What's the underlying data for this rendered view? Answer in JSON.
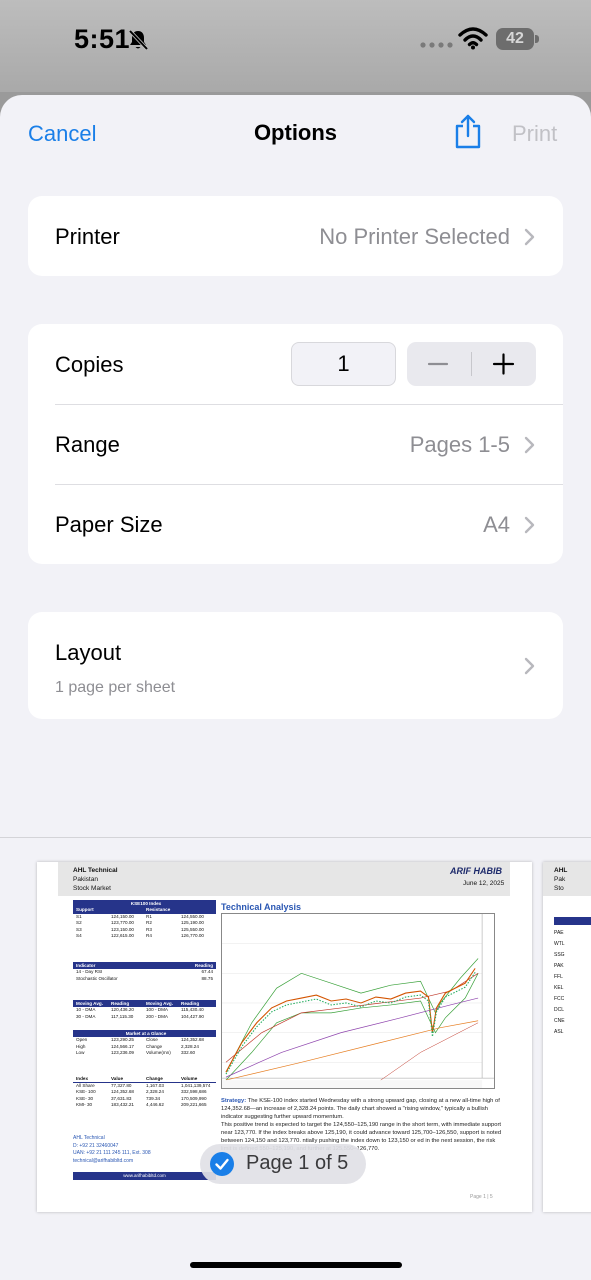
{
  "status_bar": {
    "time": "5:51",
    "battery": "42",
    "icons": [
      "bell-slash-icon",
      "signal-dots-icon",
      "wifi-icon",
      "battery-icon"
    ]
  },
  "nav": {
    "cancel": "Cancel",
    "title": "Options",
    "print": "Print",
    "share_icon": "share-icon",
    "accent_color": "#1a7fe8",
    "disabled_color": "#c1c1c6"
  },
  "printer": {
    "label": "Printer",
    "value": "No Printer Selected"
  },
  "copies": {
    "label": "Copies",
    "value": "1",
    "minus": "−",
    "plus": "+"
  },
  "range": {
    "label": "Range",
    "value": "Pages 1-5"
  },
  "paper_size": {
    "label": "Paper Size",
    "value": "A4"
  },
  "layout": {
    "label": "Layout",
    "sub": "1 page per sheet"
  },
  "preview": {
    "page_indicator": "Page 1 of 5",
    "doc": {
      "header_left": [
        "AHL Technical",
        "Pakistan",
        "Stock Market"
      ],
      "logo": "ARIF HABIB",
      "date": "June 12, 2025",
      "kse_title": "KSE100 Index",
      "support_header": "Support",
      "resistance_header": "Resistance",
      "levels": [
        [
          "S1",
          "124,150.00",
          "R1",
          "124,550.00"
        ],
        [
          "S2",
          "123,770.00",
          "R2",
          "125,190.00"
        ],
        [
          "S3",
          "123,150.00",
          "R3",
          "125,550.00"
        ],
        [
          "S4",
          "122,615.00",
          "R4",
          "126,770.00"
        ]
      ],
      "indicator_header": [
        "Indicator",
        "Reading"
      ],
      "indicators": [
        [
          "14 - Day RSI",
          "67.44"
        ],
        [
          "Stochastic Oscillator",
          "88.75"
        ]
      ],
      "ma_header": [
        "Moving Avg.",
        "Reading",
        "Moving Avg.",
        "Reading"
      ],
      "ma_rows": [
        [
          "10 - DMA",
          "120,436.20",
          "100 - DMA",
          "115,430.40"
        ],
        [
          "30 - DMA",
          "117,115.30",
          "200 - DMA",
          "104,427.90"
        ]
      ],
      "glance_header": "Market at a Glance",
      "glance_rows": [
        [
          "Open",
          "123,290.25",
          "Close",
          "124,352.68"
        ],
        [
          "High",
          "124,566.17",
          "Change",
          "2,328.24"
        ],
        [
          "Low",
          "123,236.09",
          "Volume(mn)",
          "332.60"
        ]
      ],
      "index_header": [
        "Index",
        "Value",
        "Change",
        "Volume"
      ],
      "index_rows": [
        [
          "All Share",
          "77,327.80",
          "1,167.03",
          "1,041,139,574"
        ],
        [
          "KSE- 100",
          "124,352.68",
          "2,328.24",
          "332,598,686"
        ],
        [
          "KSE- 30",
          "37,631.83",
          "739.34",
          "170,509,990"
        ],
        [
          "KMI- 30",
          "183,432.21",
          "4,446.62",
          "209,221,665"
        ]
      ],
      "contact": [
        "AHL Technical",
        "D: +92 21 32460047",
        "UAN: +92 21 111 245 111, Ext. 308",
        "technical@arifhabibltd.com"
      ],
      "website": "www.arifhabibltd.com",
      "ta_title": "Technical Analysis",
      "strategy_label": "Strategy:",
      "strategy_text": "The KSE-100 index started Wednesday with a strong upward gap, closing at a new all-time high of 124,352.68—an increase of 2,328.24 points. The daily chart showed a \"rising window,\" typically a bullish indicator suggesting further upward momentum.",
      "strategy_text2": "This positive trend is expected to target the 124,550–125,190 range in the short term, with immediate support near 123,770. If the index breaks above 125,190, it could advance toward 125,700–126,550, support is noted between 124,150 and 123,770. ntially pushing the index down to 123,150 or ed in the next session, the risk limit is defined 550–125,190, and further at 125,550–126,770.",
      "page_num": "Page 1 | 5"
    },
    "next_doc": {
      "header": [
        "AHL",
        "Pak",
        "Sto"
      ],
      "rows": [
        "Sy",
        "PAE",
        "WTL",
        "SSG",
        "PAK",
        "FFL",
        "KEL",
        "FCC",
        "DCL",
        "CNE",
        "ASL"
      ]
    }
  }
}
